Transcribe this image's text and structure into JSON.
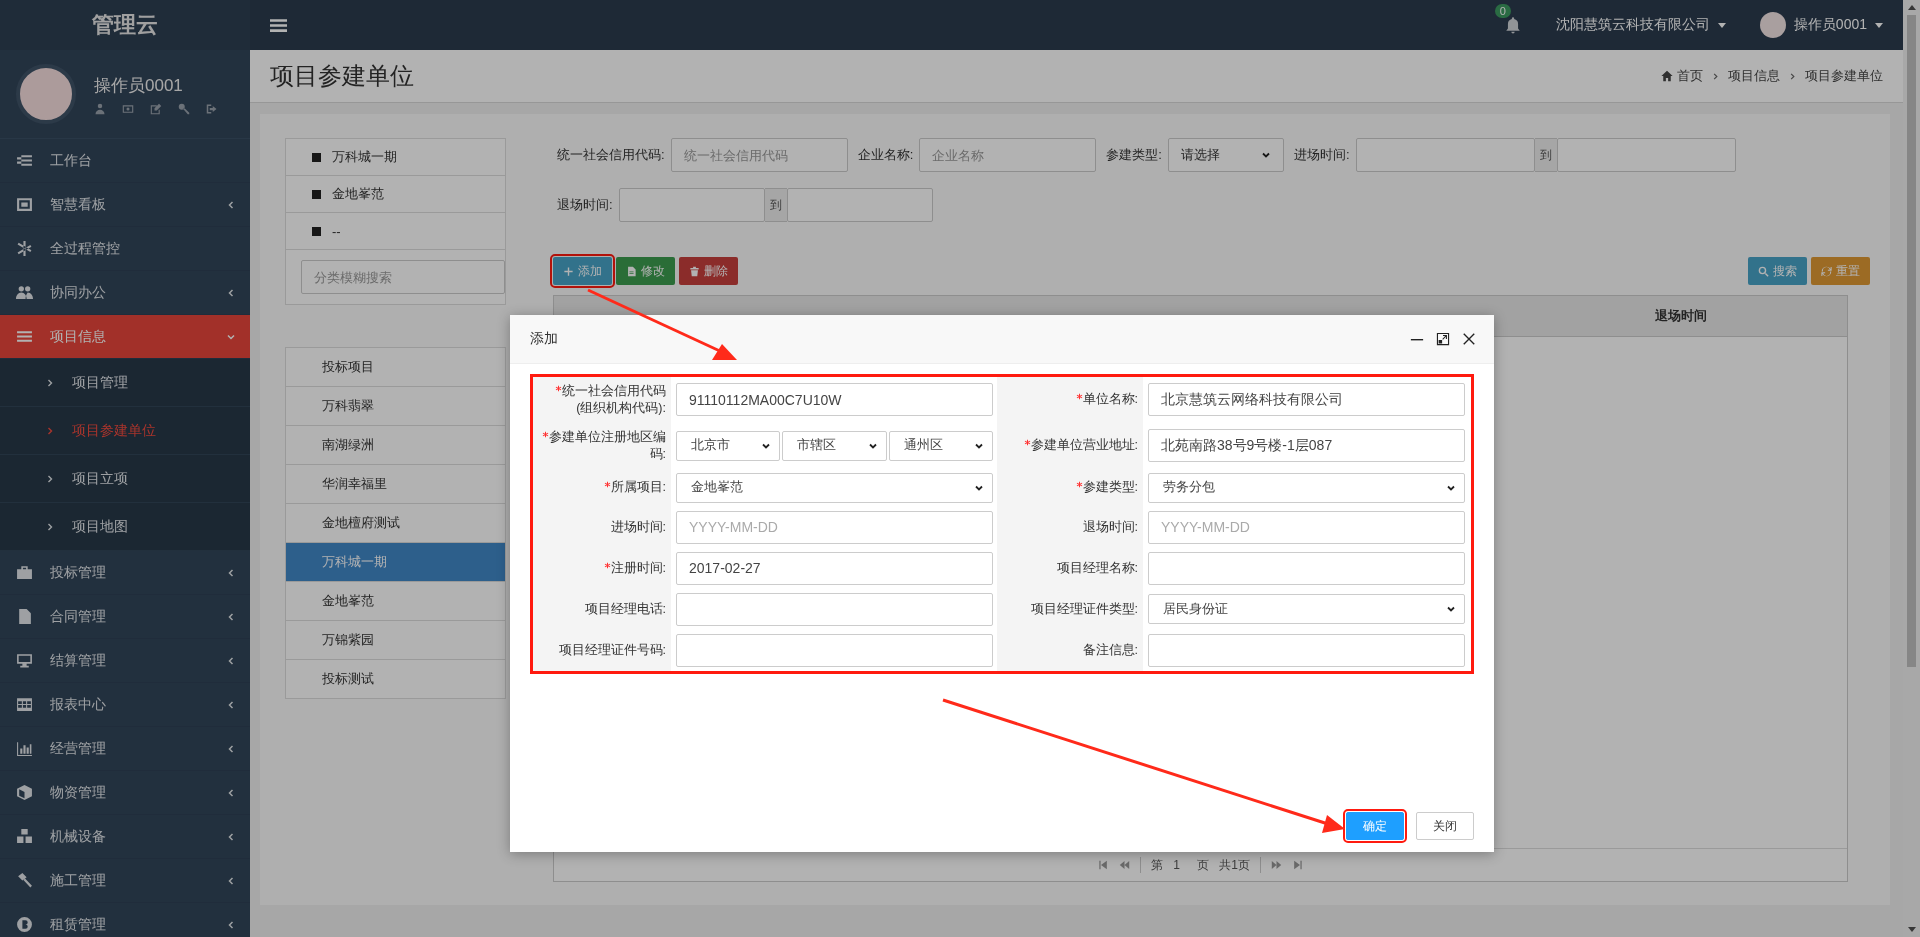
{
  "sidebar": {
    "logo": "管理云",
    "user": {
      "name": "操作员0001"
    },
    "menu": [
      {
        "label": "工作台",
        "expandable": false,
        "selected": false
      },
      {
        "label": "智慧看板",
        "expandable": true,
        "expanded": false,
        "selected": false
      },
      {
        "label": "全过程管控",
        "expandable": false,
        "selected": false
      },
      {
        "label": "协同办公",
        "expandable": true,
        "expanded": false,
        "selected": false
      },
      {
        "label": "项目信息",
        "expandable": true,
        "expanded": true,
        "selected": true,
        "children": [
          {
            "label": "项目管理",
            "selected": false
          },
          {
            "label": "项目参建单位",
            "selected": true
          },
          {
            "label": "项目立项",
            "selected": false
          },
          {
            "label": "项目地图",
            "selected": false
          }
        ]
      },
      {
        "label": "投标管理",
        "expandable": true,
        "expanded": false,
        "selected": false
      },
      {
        "label": "合同管理",
        "expandable": true,
        "expanded": false,
        "selected": false
      },
      {
        "label": "结算管理",
        "expandable": true,
        "expanded": false,
        "selected": false
      },
      {
        "label": "报表中心",
        "expandable": true,
        "expanded": false,
        "selected": false
      },
      {
        "label": "经营管理",
        "expandable": true,
        "expanded": false,
        "selected": false
      },
      {
        "label": "物资管理",
        "expandable": true,
        "expanded": false,
        "selected": false
      },
      {
        "label": "机械设备",
        "expandable": true,
        "expanded": false,
        "selected": false
      },
      {
        "label": "施工管理",
        "expandable": true,
        "expanded": false,
        "selected": false
      },
      {
        "label": "租赁管理",
        "expandable": true,
        "expanded": false,
        "selected": false
      }
    ]
  },
  "topbar": {
    "notifications": "0",
    "company": "沈阳慧筑云科技有限公司",
    "user": "操作员0001"
  },
  "page": {
    "title": "项目参建单位",
    "breadcrumb": [
      "首页",
      "项目信息",
      "项目参建单位"
    ]
  },
  "category_tree": {
    "items": [
      "万科城一期",
      "金地峯范",
      "--"
    ],
    "search": {
      "placeholder": "分类模糊搜索"
    }
  },
  "projects": [
    {
      "label": "投标项目",
      "selected": false
    },
    {
      "label": "万科翡翠",
      "selected": false
    },
    {
      "label": "南湖绿洲",
      "selected": false
    },
    {
      "label": "华润幸福里",
      "selected": false
    },
    {
      "label": "金地檀府测试",
      "selected": false
    },
    {
      "label": "万科城一期",
      "selected": true
    },
    {
      "label": "金地峯范",
      "selected": false
    },
    {
      "label": "万锦紫园",
      "selected": false
    },
    {
      "label": "投标测试",
      "selected": false
    }
  ],
  "filters": {
    "credit_code": {
      "label": "统一社会信用代码:",
      "placeholder": "统一社会信用代码"
    },
    "company": {
      "label": "企业名称:",
      "placeholder": "企业名称"
    },
    "type": {
      "label": "参建类型:",
      "value": "请选择"
    },
    "entry_time": {
      "label": "进场时间:",
      "separator": "到"
    },
    "exit_time": {
      "label": "退场时间:",
      "separator": "到"
    }
  },
  "toolbar_buttons": [
    {
      "label": "添加",
      "kind": "add",
      "highlighted": true
    },
    {
      "label": "修改",
      "kind": "edit",
      "highlighted": false
    },
    {
      "label": "删除",
      "kind": "delete",
      "highlighted": false
    }
  ],
  "search_buttons": [
    {
      "label": "搜索",
      "kind": "search"
    },
    {
      "label": "重置",
      "kind": "reset"
    }
  ],
  "table": {
    "columns": [
      "退场时间"
    ],
    "pagination": {
      "before": "第",
      "page": "1",
      "after": "页",
      "total": "共1页"
    }
  },
  "dialog": {
    "title": "添加",
    "form_highlighted": true,
    "rows": [
      [
        {
          "label": "统一社会信用代码(组织机构代码):",
          "required": true,
          "kind": "text",
          "value": "91110112MA00C7U10W"
        },
        {
          "label": "单位名称:",
          "required": true,
          "kind": "text",
          "value": "北京慧筑云网络科技有限公司"
        }
      ],
      [
        {
          "label": "参建单位注册地区编码:",
          "required": true,
          "kind": "region",
          "values": [
            "北京市",
            "市辖区",
            "通州区"
          ]
        },
        {
          "label": "参建单位营业地址:",
          "required": true,
          "kind": "text",
          "value": "北苑南路38号9号楼-1层087"
        }
      ],
      [
        {
          "label": "所属项目:",
          "required": true,
          "kind": "select",
          "value": "金地峯范"
        },
        {
          "label": "参建类型:",
          "required": true,
          "kind": "select",
          "value": "劳务分包"
        }
      ],
      [
        {
          "label": "进场时间:",
          "required": false,
          "kind": "text",
          "placeholder": "YYYY-MM-DD"
        },
        {
          "label": "退场时间:",
          "required": false,
          "kind": "text",
          "placeholder": "YYYY-MM-DD"
        }
      ],
      [
        {
          "label": "注册时间:",
          "required": true,
          "kind": "text",
          "value": "2017-02-27"
        },
        {
          "label": "项目经理名称:",
          "required": false,
          "kind": "text"
        }
      ],
      [
        {
          "label": "项目经理电话:",
          "required": false,
          "kind": "text"
        },
        {
          "label": "项目经理证件类型:",
          "required": false,
          "kind": "select",
          "value": "居民身份证"
        }
      ],
      [
        {
          "label": "项目经理证件号码:",
          "required": false,
          "kind": "text"
        },
        {
          "label": "备注信息:",
          "required": false,
          "kind": "text"
        }
      ]
    ],
    "buttons": [
      {
        "label": "确定",
        "kind": "primary",
        "highlighted": true
      },
      {
        "label": "关闭",
        "kind": "default",
        "highlighted": false
      }
    ]
  }
}
